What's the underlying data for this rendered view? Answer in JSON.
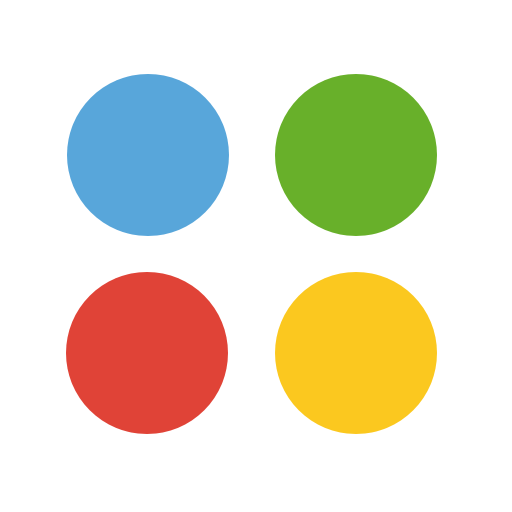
{
  "logo": {
    "icon": "four-colored-dots-icon",
    "dots": [
      {
        "position": "top-left",
        "color": "#58A6DA"
      },
      {
        "position": "top-right",
        "color": "#68B02A"
      },
      {
        "position": "bottom-left",
        "color": "#E04337"
      },
      {
        "position": "bottom-right",
        "color": "#FBC81F"
      }
    ]
  }
}
